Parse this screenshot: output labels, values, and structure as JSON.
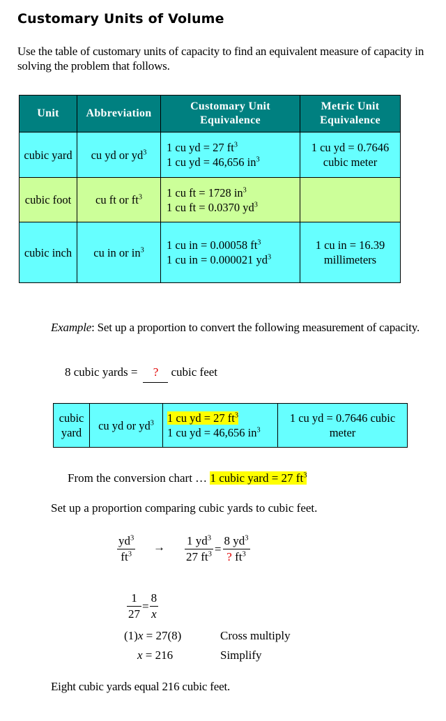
{
  "title": "Customary Units of Volume",
  "intro": "Use the table of customary units of capacity to find an equivalent measure of capacity in solving the problem that follows.",
  "units_table": {
    "headers": [
      "Unit",
      "Abbreviation",
      "Customary Unit Equivalence",
      "Metric Unit Equivalence"
    ],
    "rows": [
      {
        "unit": "cubic yard",
        "abbr": "cu yd or yd",
        "cust_1": "1 cu yd = 27 ft",
        "cust_2": "1 cu yd = 46,656 in",
        "metric": "1 cu yd = 0.7646 cubic meter",
        "color": "#66ffff"
      },
      {
        "unit": "cubic foot",
        "abbr": "cu ft or ft",
        "cust_1": "1 cu ft = 1728  in",
        "cust_2": "1 cu ft = 0.0370 yd",
        "metric": "",
        "color": "#ccff99"
      },
      {
        "unit": "cubic inch",
        "abbr": "cu in or in",
        "cust_1": "1 cu in = 0.00058  ft",
        "cust_2": "1 cu in = 0.000021  yd",
        "metric": "1 cu in = 16.39 millimeters",
        "color": "#66ffff"
      }
    ],
    "header_color": "#008080"
  },
  "example": {
    "label": "Example",
    "text": ":  Set up a proportion to convert the following measurement of capacity.",
    "problem_left": "8 cubic yards  =",
    "problem_blank": "?",
    "problem_right": "cubic feet"
  },
  "example_table": {
    "unit": "cubic yard",
    "abbr": "cu yd or yd",
    "cust_1": "1 cu yd = 27 ft",
    "cust_2": "1 cu yd = 46,656 in",
    "metric": "1 cu yd = 0.7646 cubic meter",
    "highlight_color": "#ffff00"
  },
  "from_chart": {
    "prefix": "From the conversion chart … ",
    "highlight": "1 cubic yard  = 27 ft"
  },
  "setup_text": "Set up a proportion comparing cubic yards to cubic feet.",
  "proportion": {
    "left_num": "yd",
    "left_den": "ft",
    "arrow": "→",
    "r1_num": "1 yd",
    "r1_den": "27 ft",
    "equals": "=",
    "r2_num": "8 yd",
    "r2_den_q": "?",
    "r2_den": " ft"
  },
  "solve": {
    "frac1_num": "1",
    "frac1_den": "27",
    "frac2_num": "8",
    "frac2_den": "x",
    "equals": "=",
    "step1_prefix": "(1)",
    "step1_var": "x",
    "step1_rest": " = 27(8)",
    "step1_note": "Cross multiply",
    "step2_var": "x",
    "step2_rest": " = 216",
    "step2_note": "Simplify"
  },
  "conclusion": "Eight cubic yards equal 216 cubic feet.",
  "superscript": "3"
}
